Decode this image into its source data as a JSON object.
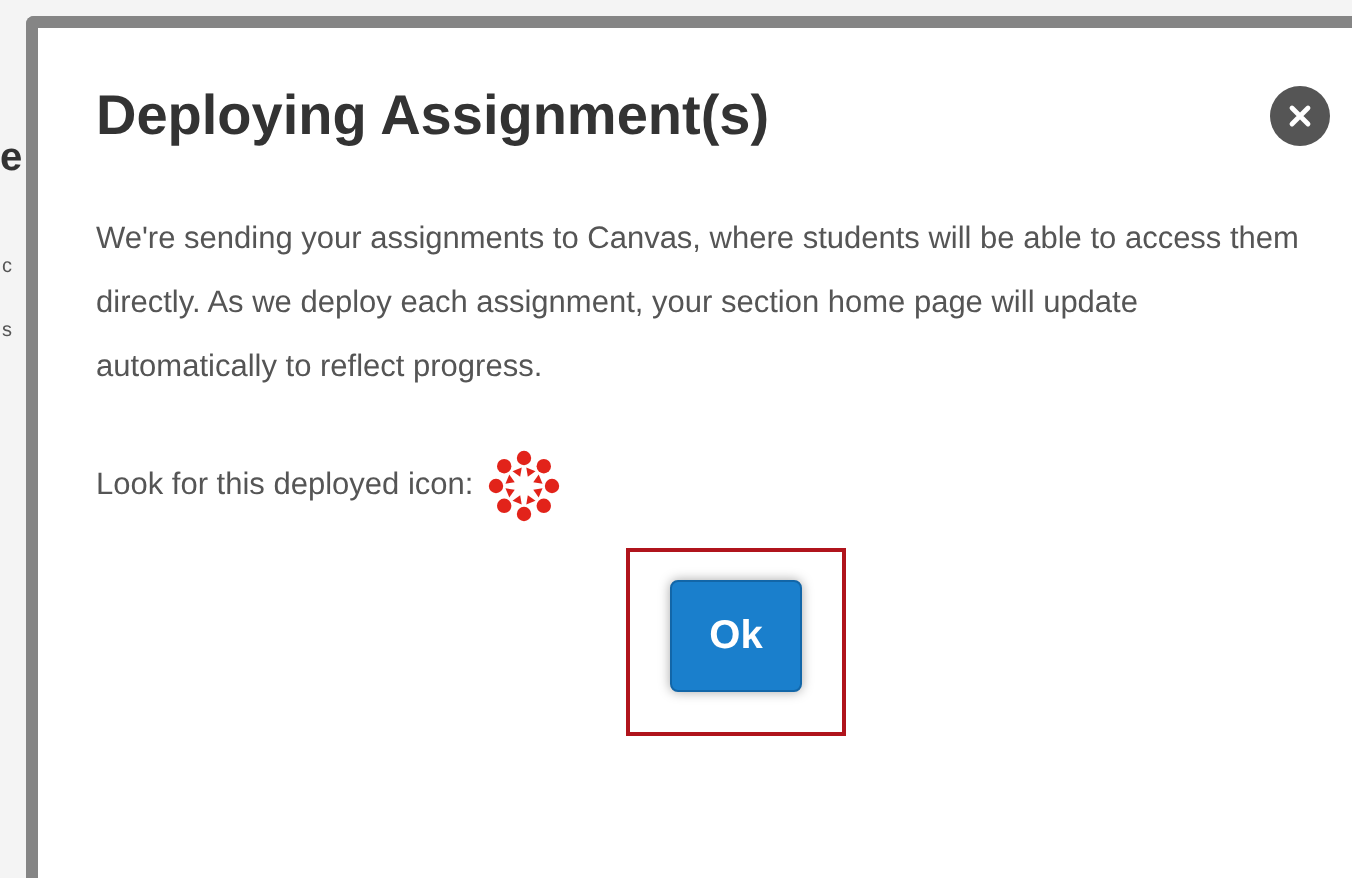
{
  "background_fragments": [
    "e",
    "c",
    "s"
  ],
  "dialog": {
    "title": "Deploying Assignment(s)",
    "message": "We're sending your assignments to Canvas, where students will be able to access them directly. As we deploy each assignment, your section home page will update automatically to reflect progress.",
    "icon_hint": "Look for this deployed icon:",
    "ok_button": {
      "label": "Ok",
      "highlighted": true
    }
  }
}
